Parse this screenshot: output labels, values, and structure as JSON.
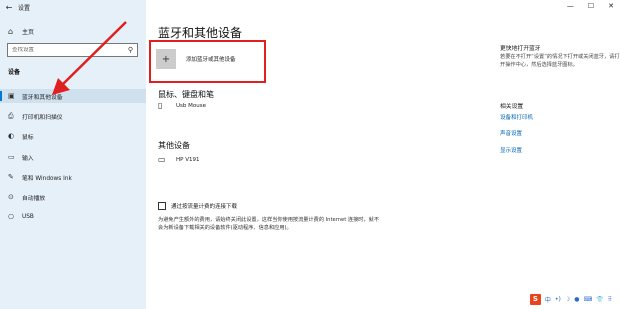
{
  "window": {
    "title": "设置",
    "minimize": "—",
    "maximize": "☐",
    "close": "✕"
  },
  "sidebar": {
    "home_label": "主页",
    "search_placeholder": "查找设置",
    "section": "设备",
    "items": [
      {
        "icon": "bluetooth-devices-icon",
        "glyph": "▣",
        "label": "蓝牙和其他设备"
      },
      {
        "icon": "printer-icon",
        "glyph": "⎙",
        "label": "打印机和扫描仪"
      },
      {
        "icon": "mouse-icon",
        "glyph": "◐",
        "label": "鼠标"
      },
      {
        "icon": "keyboard-icon",
        "glyph": "▭",
        "label": "输入"
      },
      {
        "icon": "pen-icon",
        "glyph": "✎",
        "label": "笔和 Windows Ink"
      },
      {
        "icon": "autoplay-icon",
        "glyph": "⊙",
        "label": "自动播放"
      },
      {
        "icon": "usb-icon",
        "glyph": "⎔",
        "label": "USB"
      }
    ]
  },
  "main": {
    "title": "蓝牙和其他设备",
    "add_device_label": "添加蓝牙或其他设备",
    "mouse_section": "鼠标、键盘和笔",
    "mouse_device": "Usb Mouse",
    "other_section": "其他设备",
    "other_device": "HP V191",
    "metered_label": "通过按流量计费的连接下载",
    "metered_desc": "为避免产生额外的费用，请始终关闭此设置，这样当你使用按流量计费的 Internet 连接时，就不会为新设备下载相关的设备软件(驱动程序、信息和应用)。"
  },
  "right_panel": {
    "title": "更快地打开蓝牙",
    "desc": "若要在不打开“设置”的情况下打开或关闭蓝牙，请打开操作中心，然后选择蓝牙图标。",
    "related_title": "相关设置",
    "links": [
      "设备和打印机",
      "声音设置",
      "显示设置"
    ]
  },
  "tray": {
    "ime": "S",
    "items": [
      "中",
      "•)",
      "☽",
      "●",
      "⌨",
      "👕",
      "⠿"
    ]
  },
  "colors": {
    "accent": "#0078d7",
    "highlight": "#e02020",
    "link": "#0066b4"
  }
}
